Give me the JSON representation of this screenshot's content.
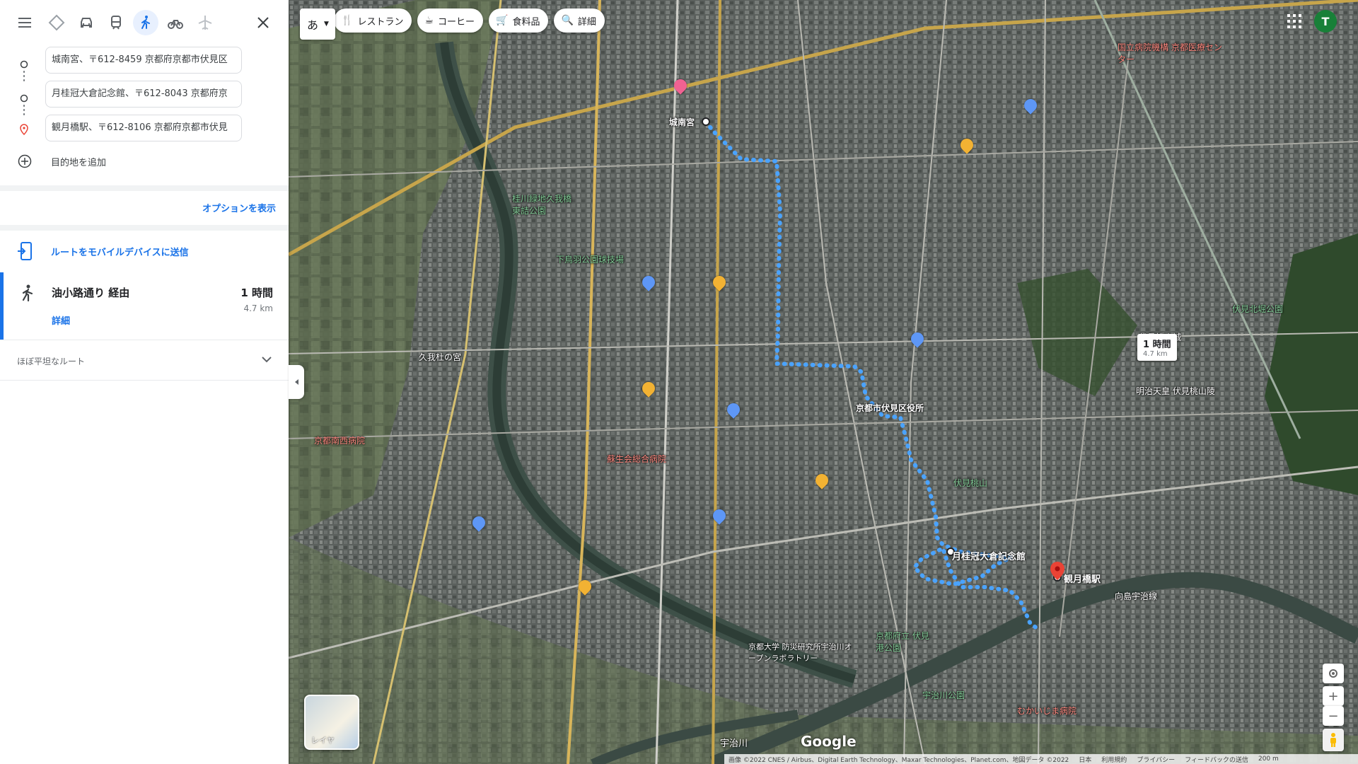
{
  "panel": {
    "waypoints": [
      {
        "value": "城南宮、〒612-8459 京都府京都市伏見区"
      },
      {
        "value": "月桂冠大倉記念館、〒612-8043 京都府京"
      },
      {
        "value": "観月橋駅、〒612-8106 京都府京都市伏見"
      }
    ],
    "add_destination": "目的地を追加",
    "show_options": "オプションを表示",
    "send_to_mobile": "ルートをモバイルデバイスに送信",
    "route": {
      "title": "油小路通り 経由",
      "duration": "1 時間",
      "distance": "4.7 km",
      "details": "詳細"
    },
    "flatness": "ほぼ平坦なルート"
  },
  "map": {
    "ime_label": "あ",
    "chips": [
      {
        "icon": "restaurant-icon",
        "label": "レストラン"
      },
      {
        "icon": "coffee-icon",
        "label": "コーヒー"
      },
      {
        "icon": "cart-icon",
        "label": "食料品"
      },
      {
        "icon": "search-icon",
        "label": "詳細"
      }
    ],
    "avatar": "T",
    "route_label": {
      "duration": "1 時間",
      "distance": "4.7 km"
    },
    "layer_label": "レイヤ",
    "google_logo": "Google",
    "places": [
      {
        "name": "城南宮"
      },
      {
        "name": "月桂冠大倉記念館"
      },
      {
        "name": "観月橋駅"
      },
      {
        "name": "京都市伏見区役所"
      },
      {
        "name": "伏見桃山城"
      },
      {
        "name": "明治天皇 伏見桃山陵"
      },
      {
        "name": "宇治川"
      },
      {
        "name": "久我杜の宮"
      },
      {
        "name": "京都南西病院"
      },
      {
        "name": "蘇生会総合病院"
      },
      {
        "name": "国立病院機構 京都医療センター"
      },
      {
        "name": "下鳥羽公園球技場"
      },
      {
        "name": "京都大学 防災研究所宇治川オープンラボラトリー"
      },
      {
        "name": "伏見桃山"
      },
      {
        "name": "向島宇治線"
      },
      {
        "name": "京都府立 伏見港公園"
      },
      {
        "name": "宇治川公園"
      },
      {
        "name": "桂川緑地久我橋東詰公園"
      },
      {
        "name": "むかいじま病院"
      },
      {
        "name": "伏見北堀公園"
      }
    ],
    "footer": [
      "画像 ©2022 CNES / Airbus、Digital Earth Technology、Maxar Technologies、Planet.com、地図データ ©2022",
      "日本",
      "利用規約",
      "プライバシー",
      "フィードバックの送信",
      "200 m"
    ],
    "colors": {
      "route": "#4aa3ff",
      "accent": "#1a73e8",
      "pin": "#ea4335"
    }
  }
}
